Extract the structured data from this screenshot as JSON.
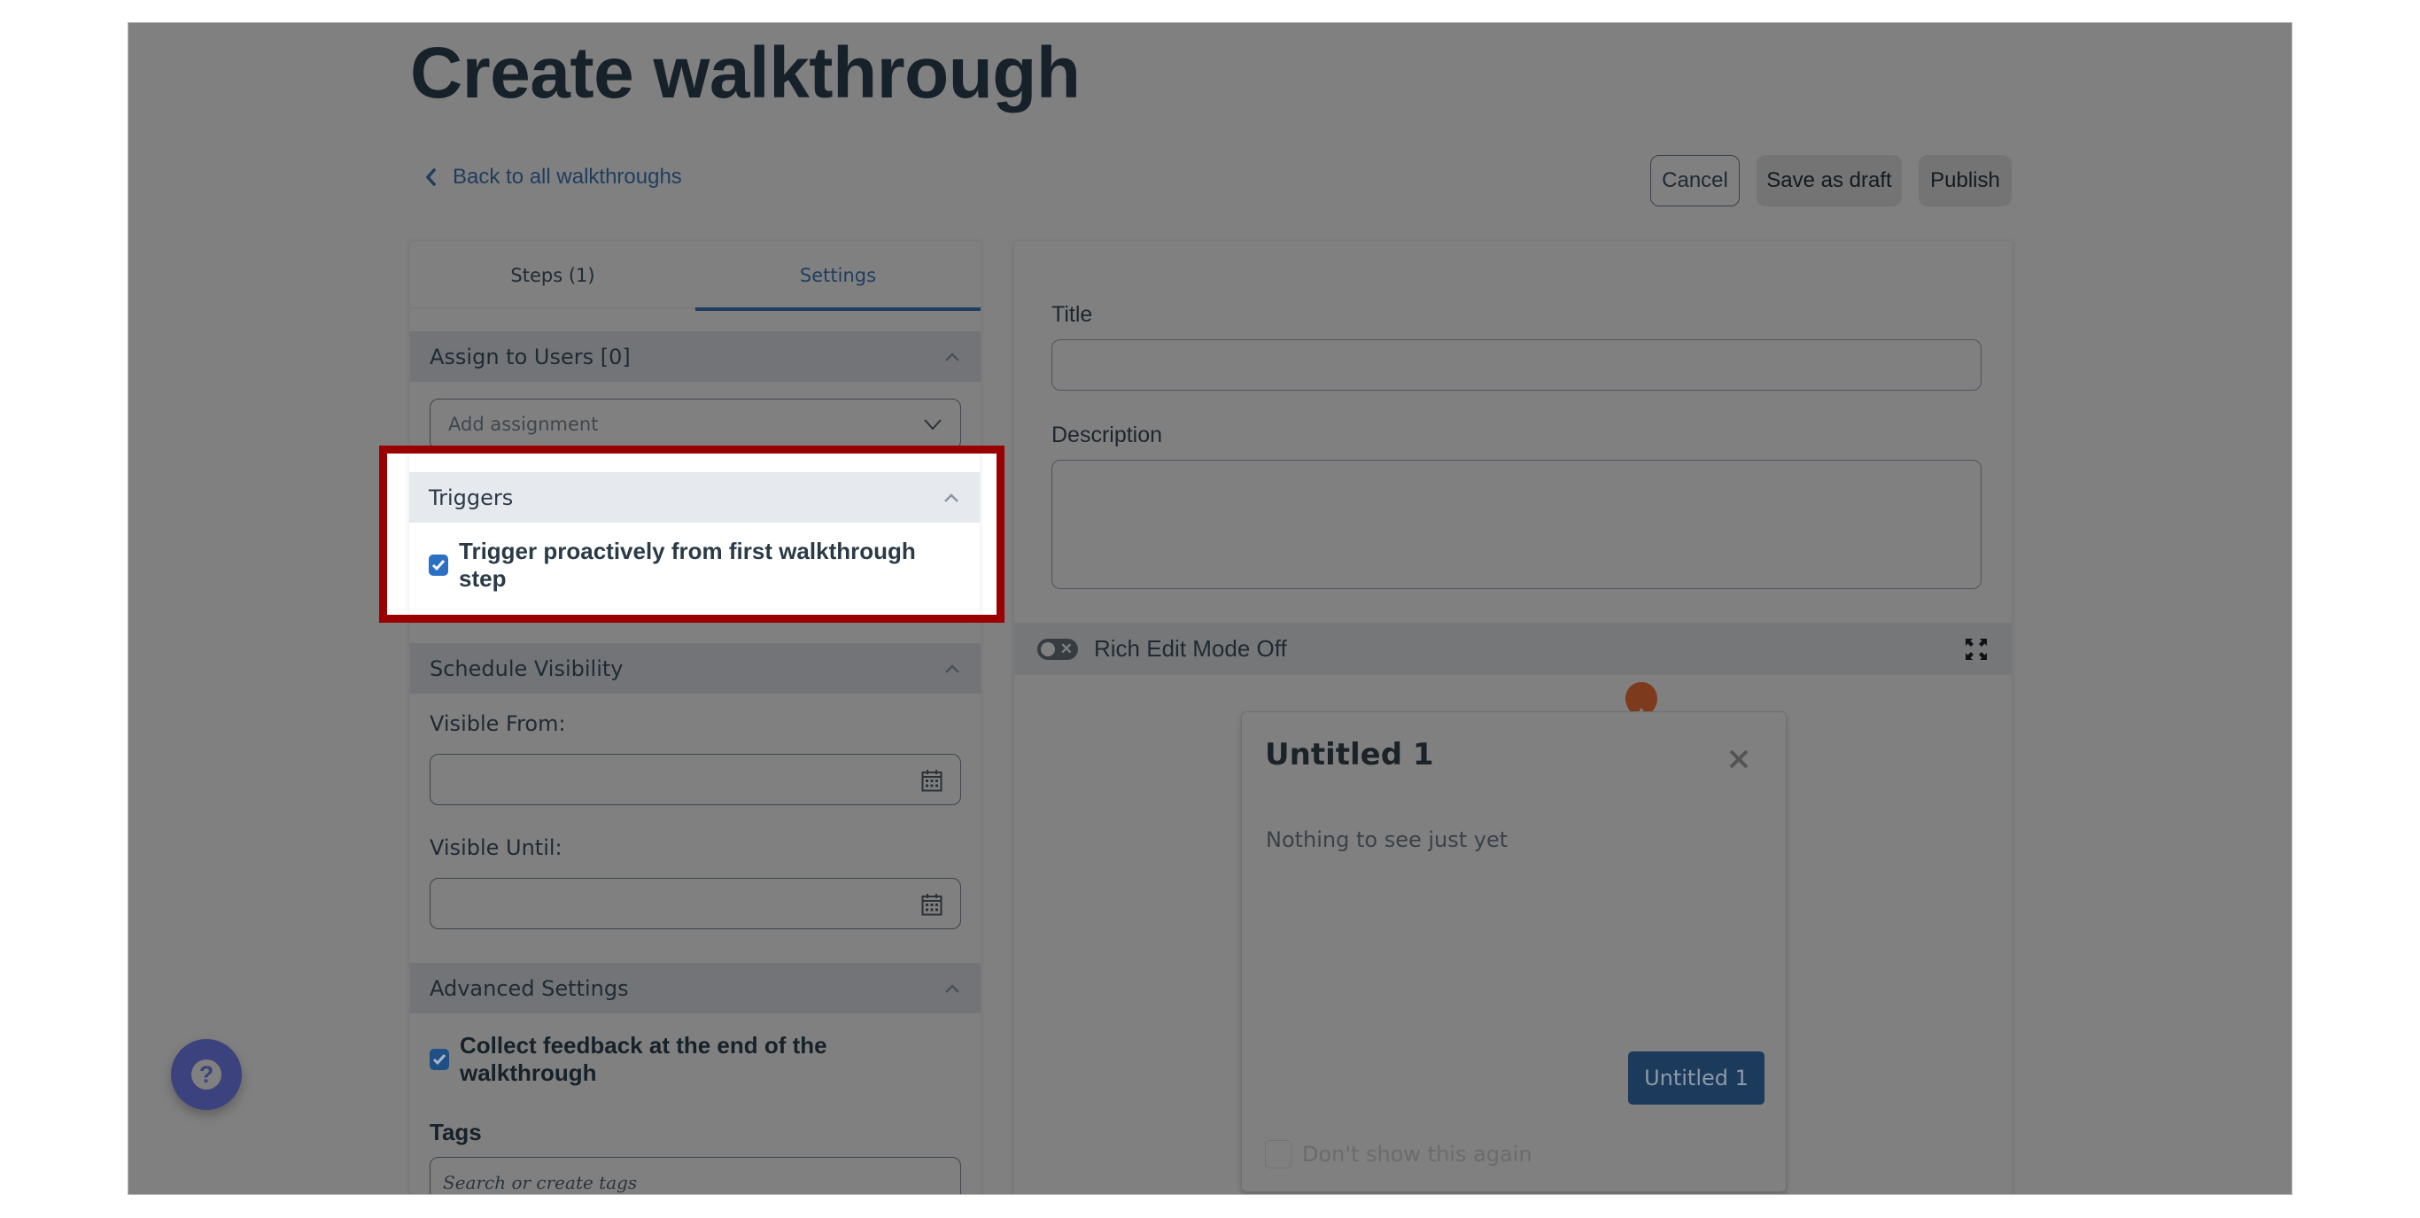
{
  "page": {
    "title": "Create walkthrough",
    "back_link": "Back to all walkthroughs"
  },
  "actions": {
    "cancel": "Cancel",
    "save_draft": "Save as draft",
    "publish": "Publish"
  },
  "tabs": [
    {
      "label": "Steps (1)",
      "active": false
    },
    {
      "label": "Settings",
      "active": true
    }
  ],
  "settings": {
    "assign": {
      "header": "Assign to Users [0]",
      "dropdown_placeholder": "Add assignment"
    },
    "triggers": {
      "header": "Triggers",
      "checkbox_label": "Trigger proactively from first walkthrough step",
      "checked": true,
      "highlighted": true
    },
    "schedule": {
      "header": "Schedule Visibility",
      "visible_from_label": "Visible From:",
      "visible_from_value": "",
      "visible_until_label": "Visible Until:",
      "visible_until_value": ""
    },
    "advanced": {
      "header": "Advanced Settings",
      "feedback_label": "Collect feedback at the end of the walkthrough",
      "feedback_checked": true,
      "tags_label": "Tags",
      "tags_placeholder": "Search or create tags"
    }
  },
  "editor": {
    "title_label": "Title",
    "title_value": "",
    "description_label": "Description",
    "description_value": "",
    "rich_edit_label": "Rich Edit Mode Off",
    "rich_edit_on": false
  },
  "preview": {
    "step_title": "Untitled 1",
    "body": "Nothing to see just yet",
    "button_label": "Untitled 1",
    "dont_show_label": "Don't show this again",
    "dont_show_checked": false
  },
  "colors": {
    "overlay_gray": "#808080",
    "highlight_border": "#9b0000",
    "accent_blue": "#2b70c2",
    "marker_orange": "#c2451e",
    "help_fab": "#3c427d"
  },
  "icons": {
    "back": "chevron-left-icon",
    "section_caret": "chevron-up-icon",
    "dropdown": "chevron-down-icon",
    "calendar": "calendar-icon",
    "toggle": "toggle-off-icon",
    "expand": "expand-icon",
    "close": "close-icon",
    "help": "help-icon"
  }
}
